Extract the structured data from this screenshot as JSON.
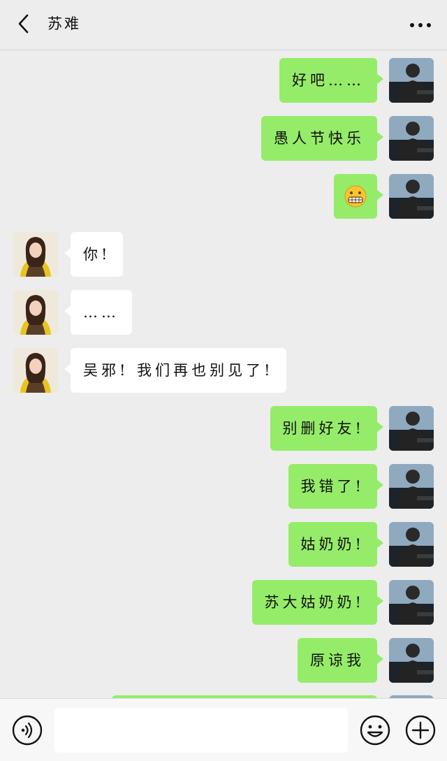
{
  "header": {
    "title": "苏难",
    "back_icon": "chevron-left-icon",
    "more_icon": "more-dots-icon"
  },
  "messages": [
    {
      "side": "me",
      "text": "好吧……"
    },
    {
      "side": "me",
      "text": "愚人节快乐"
    },
    {
      "side": "me",
      "text": "",
      "emoji": "grimacing-face-emoji"
    },
    {
      "side": "them",
      "text": "你!"
    },
    {
      "side": "them",
      "text": "……"
    },
    {
      "side": "them",
      "text": "吴邪! 我们再也别见了!"
    },
    {
      "side": "me",
      "text": "别删好友!"
    },
    {
      "side": "me",
      "text": "我错了!"
    },
    {
      "side": "me",
      "text": "姑奶奶!"
    },
    {
      "side": "me",
      "text": "苏大姑奶奶!"
    },
    {
      "side": "me",
      "text": "原谅我"
    }
  ],
  "input_bar": {
    "voice_icon": "voice-icon",
    "input_value": "",
    "emoji_icon": "emoji-smile-icon",
    "plus_icon": "plus-icon"
  },
  "colors": {
    "my_bubble": "#95ec69",
    "their_bubble": "#ffffff",
    "background": "#ededed"
  }
}
